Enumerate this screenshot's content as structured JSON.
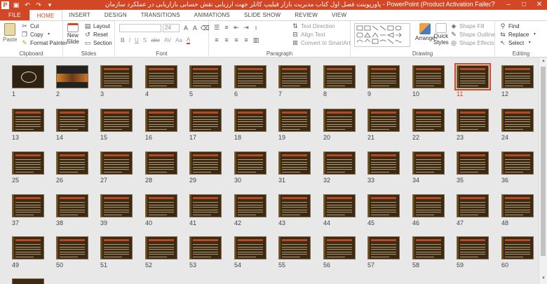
{
  "window": {
    "title": "پاورپوینت فصل اول کتاب مدیریت بازار فیلیپ کاتلر جهت ارزیابی نقش حسابی بازاریابی در عملکرد سازمان  -  PowerPoint (Product Activation Failed)",
    "controls": [
      "?",
      "–",
      "□",
      "✕"
    ],
    "accent": "#d24726"
  },
  "tabs": [
    "FILE",
    "HOME",
    "INSERT",
    "DESIGN",
    "TRANSITIONS",
    "ANIMATIONS",
    "SLIDE SHOW",
    "REVIEW",
    "VIEW"
  ],
  "active_tab": "HOME",
  "ribbon": {
    "clipboard": {
      "paste": "Paste",
      "cut": "Cut",
      "copy": "Copy",
      "format_painter": "Format Painter",
      "label": "Clipboard"
    },
    "slides": {
      "new_slide_1": "New",
      "new_slide_2": "Slide",
      "layout": "Layout",
      "reset": "Reset",
      "section": "Section",
      "label": "Slides"
    },
    "font": {
      "size": "24",
      "bold": "B",
      "italic": "I",
      "underline": "U",
      "shadow": "S",
      "strike": "abc",
      "spacing": "AV",
      "case": "Aa",
      "color": "A",
      "label": "Font"
    },
    "paragraph": {
      "text_direction": "Text Direction",
      "align_text": "Align Text",
      "convert_smartart": "Convert to SmartArt",
      "label": "Paragraph"
    },
    "drawing": {
      "arrange": "Arrange",
      "quick_styles_1": "Quick",
      "quick_styles_2": "Styles",
      "shape_fill": "Shape Fill",
      "shape_outline": "Shape Outline",
      "shape_effects": "Shape Effects",
      "label": "Drawing"
    },
    "editing": {
      "find": "Find",
      "replace": "Replace",
      "select": "Select",
      "label": "Editing"
    }
  },
  "slides": {
    "count": 60,
    "selected": 11,
    "numbers": [
      "1",
      "2",
      "3",
      "4",
      "5",
      "6",
      "7",
      "8",
      "9",
      "10",
      "11",
      "12",
      "13",
      "14",
      "15",
      "16",
      "17",
      "18",
      "19",
      "20",
      "21",
      "22",
      "23",
      "24",
      "25",
      "26",
      "27",
      "28",
      "29",
      "30",
      "31",
      "32",
      "33",
      "34",
      "35",
      "36",
      "37",
      "38",
      "39",
      "40",
      "41",
      "42",
      "43",
      "44",
      "45",
      "46",
      "47",
      "48",
      "49",
      "50",
      "51",
      "52",
      "53",
      "54",
      "55",
      "56",
      "57",
      "58",
      "59",
      "60"
    ]
  }
}
